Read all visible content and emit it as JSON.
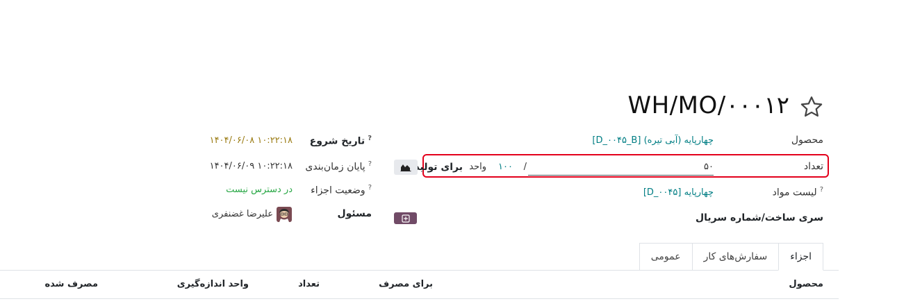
{
  "header": {
    "title": "WH/MO/۰۰۰۱۲"
  },
  "fields": {
    "product_label": "محصول",
    "product_value": "[D_۰۰۴۵_B] چهارپایه (آبی تیره)",
    "quantity_label": "تعداد",
    "quantity_value": "۵۰",
    "quantity_separator": "/",
    "quantity_produce": "۱۰۰",
    "uom_label": "واحد",
    "to_produce_label": "برای تولید",
    "bom_label": "لیست مواد",
    "bom_value": "[D_۰۰۴۵] چهارپایه",
    "lot_label": "سری ساخت/شماره سریال",
    "start_date_label": "تاریخ شروع",
    "start_date_value": "۱۴۰۴/۰۶/۰۸ ۱۰:۲۲:۱۸",
    "end_date_label": "پایان زمان‌بندی",
    "end_date_value": "۱۴۰۴/۰۶/۰۹ ۱۰:۲۲:۱۸",
    "components_status_label": "وضعیت اجزاء",
    "components_status_value": "در دسترس نیست",
    "responsible_label": "مسئول",
    "responsible_value": "علیرضا غضنفری",
    "help_mark": "?"
  },
  "tabs": [
    "اجزاء",
    "سفارش‌های کار",
    "عمومی"
  ],
  "table_headers": {
    "product": "محصول",
    "to_consume": "برای مصرف",
    "quantity": "تعداد",
    "uom": "واحد اندازه‌گیری",
    "consumed": "مصرف شده"
  },
  "icons": {
    "star": "star-icon",
    "chart": "area-chart-icon",
    "add": "plus-square-icon",
    "avatar": "user-avatar"
  },
  "colors": {
    "link": "#017e84",
    "date_warning": "#9a7b12",
    "status": "#28a745",
    "highlight": "#e3001b",
    "primary": "#714b67"
  }
}
